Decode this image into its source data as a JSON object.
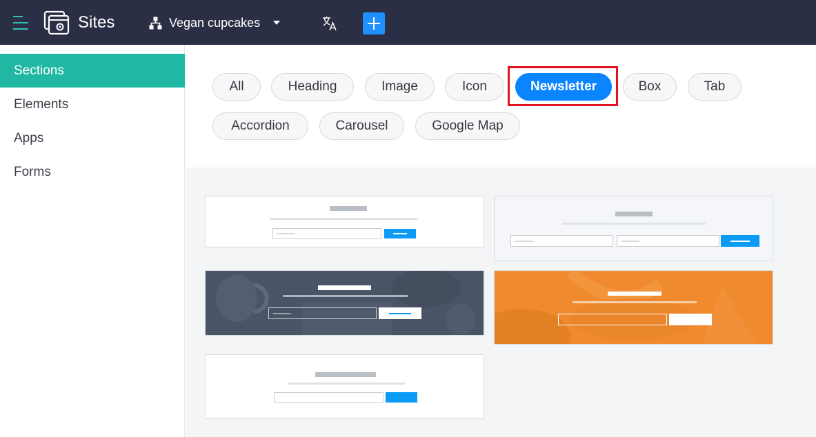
{
  "header": {
    "app_title": "Sites",
    "site_name": "Vegan cupcakes",
    "icons": {
      "menu": "hamburger-menu-icon",
      "logo": "sites-logo-icon",
      "sitemap": "sitemap-icon",
      "dropdown": "chevron-down-icon",
      "translate": "translate-icon",
      "add": "plus-icon"
    }
  },
  "sidebar": {
    "items": [
      {
        "label": "Sections",
        "active": true
      },
      {
        "label": "Elements",
        "active": false
      },
      {
        "label": "Apps",
        "active": false
      },
      {
        "label": "Forms",
        "active": false
      }
    ]
  },
  "filters": [
    {
      "label": "All",
      "active": false
    },
    {
      "label": "Heading",
      "active": false
    },
    {
      "label": "Image",
      "active": false
    },
    {
      "label": "Icon",
      "active": false
    },
    {
      "label": "Newsletter",
      "active": true
    },
    {
      "label": "Box",
      "active": false
    },
    {
      "label": "Tab",
      "active": false
    },
    {
      "label": "Accordion",
      "active": false
    },
    {
      "label": "Carousel",
      "active": false
    },
    {
      "label": "Google Map",
      "active": false
    }
  ],
  "templates": [
    {
      "style": "white"
    },
    {
      "style": "light-gray"
    },
    {
      "style": "dark-photo"
    },
    {
      "style": "orange"
    },
    {
      "style": "white"
    }
  ],
  "colors": {
    "topbar": "#2b2f45",
    "sidebar_active": "#21b8a3",
    "chip_active": "#0a84ff",
    "highlight": "#e0141e",
    "card_button": "#0a9cf5",
    "orange_template": "#ef8a2e",
    "dark_template": "#4a5467"
  }
}
